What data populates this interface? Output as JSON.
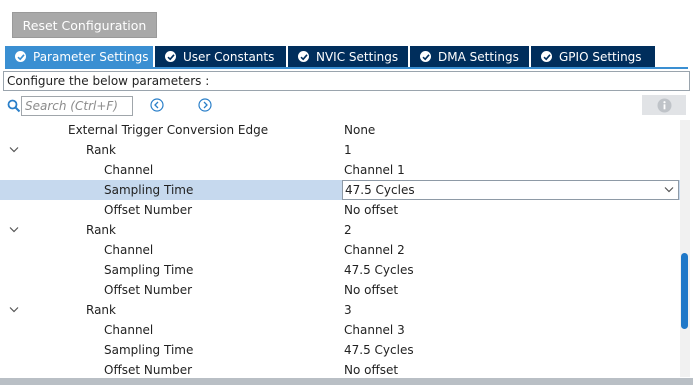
{
  "toolbar": {
    "reset_label": "Reset Configuration"
  },
  "tabs": [
    {
      "label": "Parameter Settings",
      "active": true
    },
    {
      "label": "User Constants",
      "active": false
    },
    {
      "label": "NVIC Settings",
      "active": false
    },
    {
      "label": "DMA Settings",
      "active": false
    },
    {
      "label": "GPIO Settings",
      "active": false
    }
  ],
  "description": "Configure the below parameters :",
  "search": {
    "placeholder": "Search (Ctrl+F)"
  },
  "icons": {
    "search": "search-icon",
    "prev": "arrow-left-circle-icon",
    "next": "arrow-right-circle-icon",
    "info": "info-icon",
    "collapse": "chevron-down-icon",
    "check": "check-circle-icon"
  },
  "colors": {
    "tab_active": "#3a8fd2",
    "tab_inactive": "#002e5c",
    "selection": "#c6d9ee",
    "scrollbar": "#1f78c8"
  },
  "params": {
    "trigger_edge": {
      "label": "External Trigger Conversion Edge",
      "value": "None"
    },
    "rank1": {
      "label": "Rank",
      "value": "1",
      "channel": {
        "label": "Channel",
        "value": "Channel 1"
      },
      "sampling": {
        "label": "Sampling Time",
        "value": "47.5 Cycles"
      },
      "offset": {
        "label": "Offset Number",
        "value": "No offset"
      }
    },
    "rank2": {
      "label": "Rank",
      "value": "2",
      "channel": {
        "label": "Channel",
        "value": "Channel 2"
      },
      "sampling": {
        "label": "Sampling Time",
        "value": "47.5 Cycles"
      },
      "offset": {
        "label": "Offset Number",
        "value": "No offset"
      }
    },
    "rank3": {
      "label": "Rank",
      "value": "3",
      "channel": {
        "label": "Channel",
        "value": "Channel 3"
      },
      "sampling": {
        "label": "Sampling Time",
        "value": "47.5 Cycles"
      },
      "offset": {
        "label": "Offset Number",
        "value": "No offset"
      }
    }
  }
}
